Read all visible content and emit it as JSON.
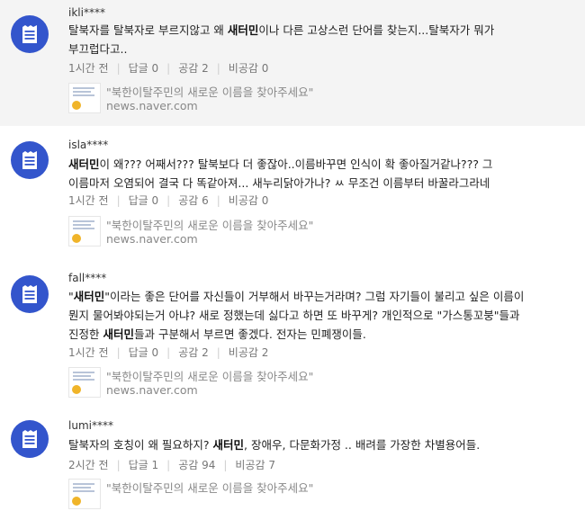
{
  "comments": [
    {
      "user": "ikli****",
      "parts": [
        {
          "t": "탈북자를 탈북자로 부르지않고 왜 "
        },
        {
          "t": "새터민",
          "b": true
        },
        {
          "t": "이나 다른 고상스런 단어를 찾는지...탈북자가 뭐가 부끄럽다고.."
        }
      ],
      "time": "1시간 전",
      "reply": "답글 0",
      "like": "공감 2",
      "dislike": "비공감 0",
      "link_title": "\"북한이탈주민의 새로운 이름을 찾아주세요\"",
      "link_domain": "news.naver.com"
    },
    {
      "user": "isla****",
      "parts": [
        {
          "t": "새터민",
          "b": true
        },
        {
          "t": "이 왜??? 어째서??? 탈북보다 더 좋잖아..이름바꾸면 인식이 확 좋아질거같나??? 그 이름마저 오염되어 결국 다 똑같아져... 새누리닭아가나? ㅆ 무조건 이름부터 바꿀라그라네"
        }
      ],
      "time": "1시간 전",
      "reply": "답글 0",
      "like": "공감 6",
      "dislike": "비공감 0",
      "link_title": "\"북한이탈주민의 새로운 이름을 찾아주세요\"",
      "link_domain": "news.naver.com"
    },
    {
      "user": "fall****",
      "parts": [
        {
          "t": "\""
        },
        {
          "t": "새터민",
          "b": true
        },
        {
          "t": "\"이라는 좋은 단어를 자신들이 거부해서 바꾸는거라며? 그럼 자기들이 불리고 싶은 이름이 뭔지 물어봐야되는거 아냐? 새로 정했는데 싫다고 하면 또 바꾸게? 개인적으로 \"가스통꼬붕\"들과 진정한 "
        },
        {
          "t": "새터민",
          "b": true
        },
        {
          "t": "들과 구분해서 부르면 좋겠다. 전자는 민폐쟁이들."
        }
      ],
      "time": "1시간 전",
      "reply": "답글 0",
      "like": "공감 2",
      "dislike": "비공감 2",
      "link_title": "\"북한이탈주민의 새로운 이름을 찾아주세요\"",
      "link_domain": "news.naver.com"
    },
    {
      "user": "lumi****",
      "parts": [
        {
          "t": "탈북자의 호칭이 왜 필요하지? "
        },
        {
          "t": "새터민",
          "b": true
        },
        {
          "t": ", 장애우, 다문화가정 .. 배려를 가장한 차별용어들."
        }
      ],
      "time": "2시간 전",
      "reply": "답글 1",
      "like": "공감 94",
      "dislike": "비공감 7",
      "link_title": "\"북한이탈주민의 새로운 이름을 찾아주세요\"",
      "link_domain": ""
    }
  ]
}
